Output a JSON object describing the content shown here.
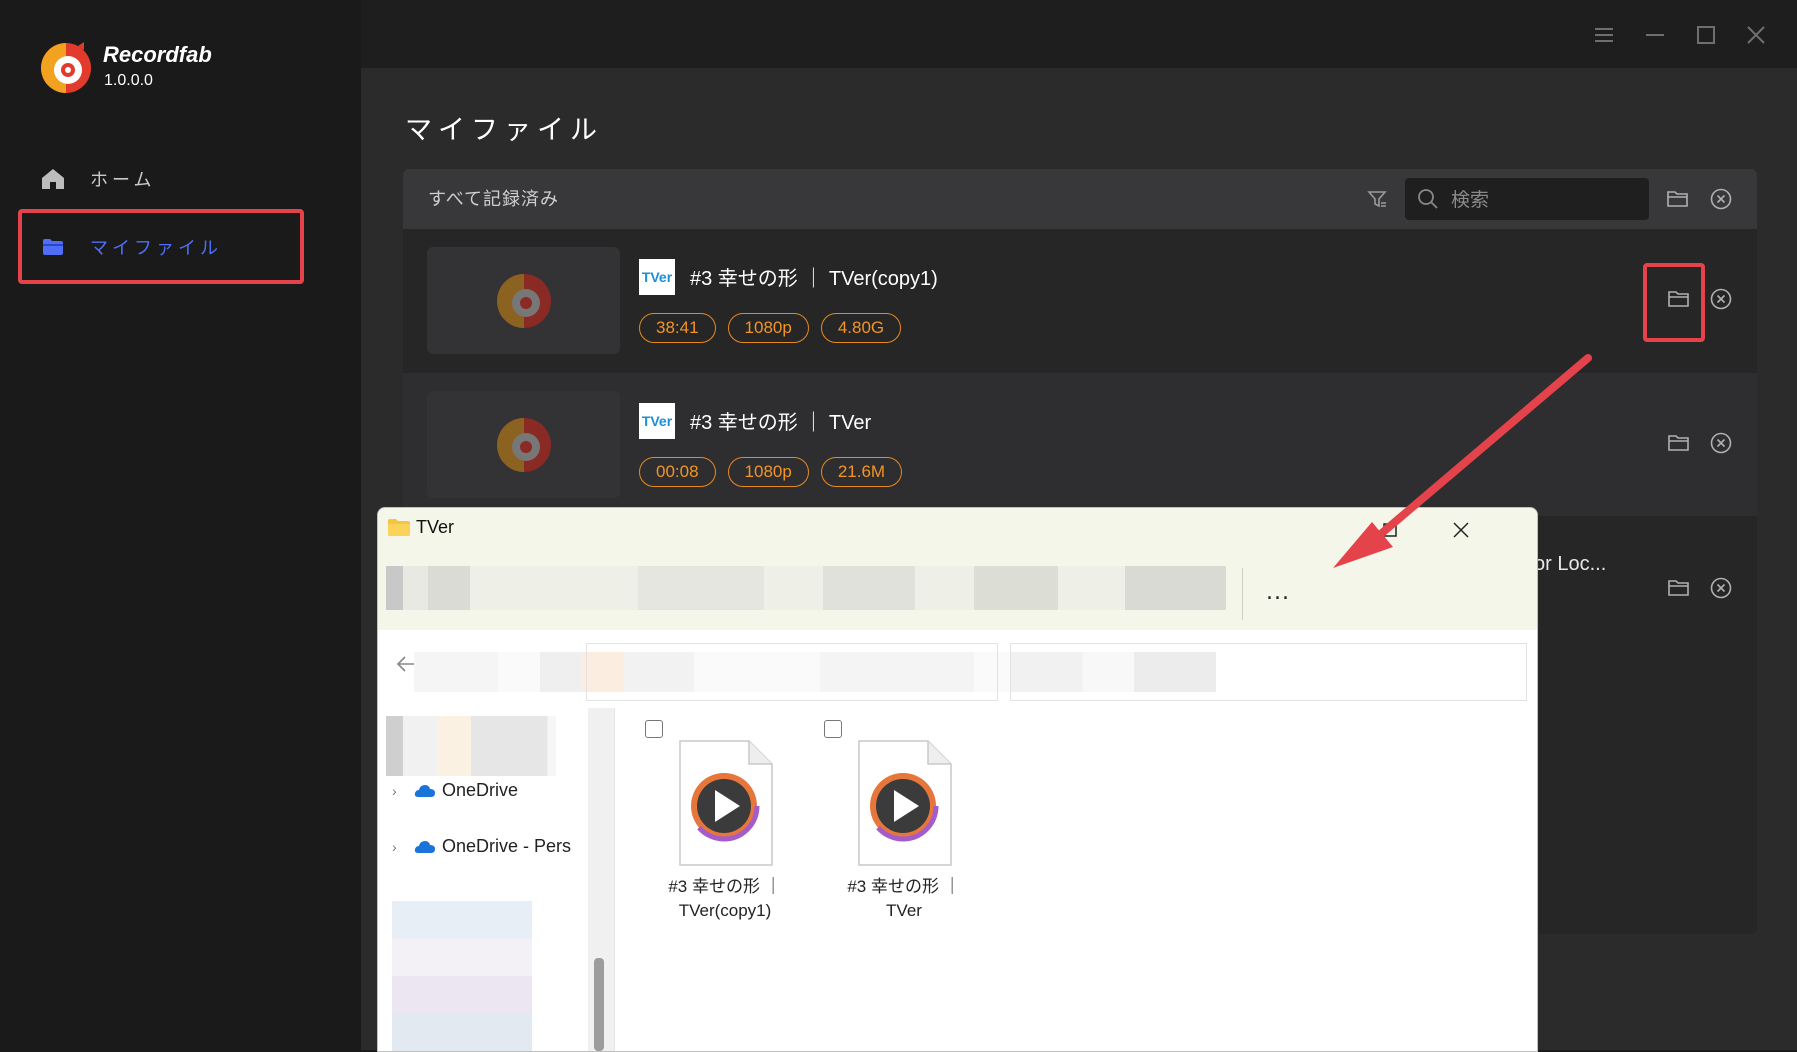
{
  "app": {
    "name": "Recordfab",
    "version": "1.0.0.0"
  },
  "sidebar": {
    "items": [
      {
        "label": "ホーム",
        "icon": "home-icon"
      },
      {
        "label": "マイファイル",
        "icon": "folder-icon",
        "active": true
      }
    ]
  },
  "window_controls": [
    "menu-icon",
    "minimize-icon",
    "maximize-icon",
    "close-icon"
  ],
  "page": {
    "title": "マイファイル"
  },
  "list_header": {
    "label": "すべて記録済み",
    "search_placeholder": "検索"
  },
  "recordings": [
    {
      "title": "#3 幸せの形 ｜ TVer(copy1)",
      "service_logo": "TVer",
      "duration": "38:41",
      "resolution": "1080p",
      "size": "4.80G"
    },
    {
      "title": "#3 幸せの形 ｜ TVer",
      "service_logo": "TVer",
      "duration": "00:08",
      "resolution": "1080p",
      "size": "21.6M"
    },
    {
      "title_visible": "or Loc..."
    }
  ],
  "explorer": {
    "title": "TVer",
    "more_label": "...",
    "nav": [
      {
        "label": "OneDrive"
      },
      {
        "label": "OneDrive - Pers"
      }
    ],
    "files": [
      {
        "line1": "#3 幸せの形 ｜",
        "line2": "TVer(copy1)"
      },
      {
        "line1": "#3 幸せの形 ｜",
        "line2": "TVer"
      }
    ]
  },
  "colors": {
    "accent_blue": "#4f6ef7",
    "tag_orange": "#f39425",
    "highlight_red": "#e5434b"
  }
}
